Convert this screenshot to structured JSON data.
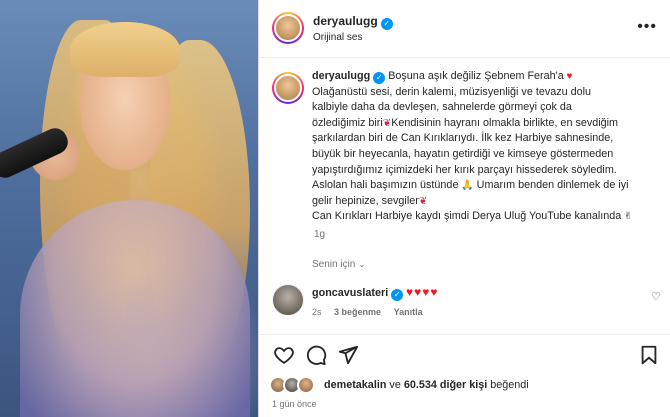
{
  "post": {
    "username": "deryaulugg",
    "audio_label": "Orijinal ses",
    "more_label": "•••"
  },
  "caption": {
    "username": "deryaulugg",
    "lines": [
      " Boşuna aşık değiliz Şebnem Ferah'a",
      "Olağanüstü sesi, derin kalemi, müzisyenliği ve tevazu dolu",
      "kalbiyle daha da devleşen, sahnelerde görmeyi çok da",
      "özlediğimiz biri",
      "Kendisinin hayranı olmakla birlikte, en sevdiğim",
      "şarkılardan biri de Can Kırıklarıydı. İlk kez Harbiye sahnesinde,",
      "büyük bir heyecanla, hayatın getirdiği ve kimseye göstermeden",
      "yapıştırdığımız içimizdeki her kırık parçayı hissederek söyledim.",
      "Aslolan hali başımızın üstünde",
      " Umarım benden dinlemek de iyi",
      "gelir hepinize, sevgiler",
      "Can Kırıkları Harbiye kaydı şimdi Derya Uluğ YouTube kanalında"
    ],
    "time": "1g"
  },
  "for_you_label": "Senin için",
  "comment": {
    "username": "goncavuslateri",
    "hearts": "♥♥♥♥",
    "time": "2s",
    "likes": "3 beğenme",
    "reply": "Yanıtla"
  },
  "likes": {
    "user": "demetakalin",
    "middle": " ve ",
    "count": "60.534 diğer kişi",
    "suffix": " beğendi"
  },
  "date": "1 gün önce",
  "colors": {
    "verified": "#0095f6",
    "heart": "#ed1c24",
    "rose": "#d2243a",
    "muted": "#737373",
    "text": "#262626"
  }
}
